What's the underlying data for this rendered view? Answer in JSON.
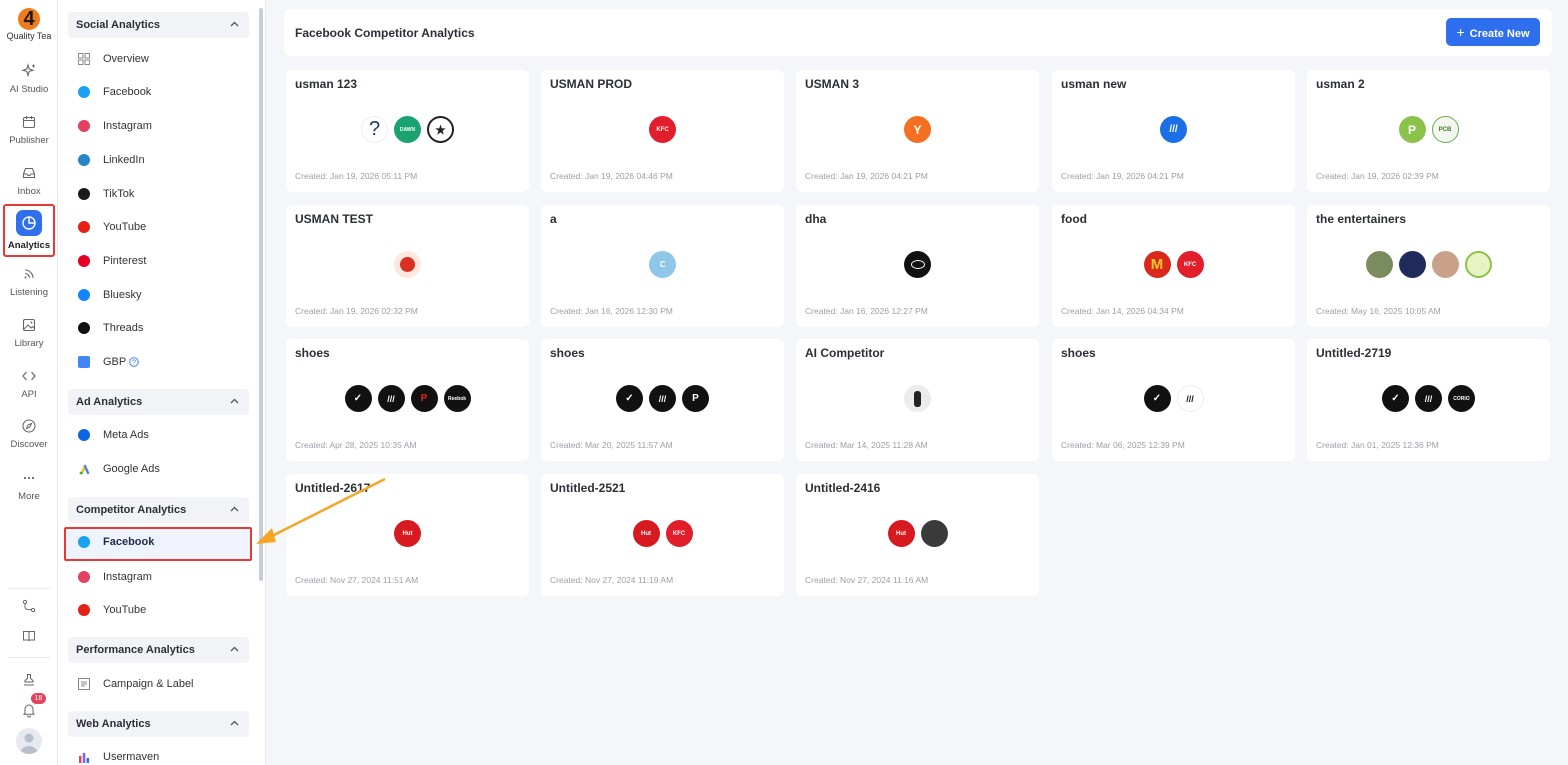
{
  "rail": {
    "logo_text": "Quality Tea",
    "items": [
      {
        "label": "AI Studio",
        "icon": "sparkle-icon"
      },
      {
        "label": "Publisher",
        "icon": "calendar-icon"
      },
      {
        "label": "Inbox",
        "icon": "inbox-icon"
      },
      {
        "label": "Analytics",
        "icon": "pie-chart-icon"
      },
      {
        "label": "Listening",
        "icon": "rss-icon"
      },
      {
        "label": "Library",
        "icon": "image-icon"
      },
      {
        "label": "API",
        "icon": "code-icon"
      },
      {
        "label": "Discover",
        "icon": "compass-icon"
      },
      {
        "label": "More",
        "icon": "ellipsis-icon"
      }
    ],
    "notification_count": "18"
  },
  "sidebar": {
    "social_analytics": {
      "heading": "Social Analytics",
      "items": [
        "Overview",
        "Facebook",
        "Instagram",
        "LinkedIn",
        "TikTok",
        "YouTube",
        "Pinterest",
        "Bluesky",
        "Threads",
        "GBP"
      ]
    },
    "ad_analytics": {
      "heading": "Ad Analytics",
      "items": [
        "Meta Ads",
        "Google Ads"
      ]
    },
    "competitor_analytics": {
      "heading": "Competitor Analytics",
      "items": [
        "Facebook",
        "Instagram",
        "YouTube"
      ]
    },
    "performance_analytics": {
      "heading": "Performance Analytics",
      "items": [
        "Campaign & Label"
      ]
    },
    "web_analytics": {
      "heading": "Web Analytics",
      "items": [
        "Usermaven"
      ]
    }
  },
  "header": {
    "title": "Facebook Competitor Analytics",
    "create_label": "Create New"
  },
  "cards": [
    {
      "name": "usman 123",
      "created": "Created: Jan 19, 2026 05:11 PM"
    },
    {
      "name": "USMAN PROD",
      "created": "Created: Jan 19, 2026 04:46 PM"
    },
    {
      "name": "USMAN 3",
      "created": "Created: Jan 19, 2026 04:21 PM"
    },
    {
      "name": "usman new",
      "created": "Created: Jan 19, 2026 04:21 PM"
    },
    {
      "name": "usman 2",
      "created": "Created: Jan 19, 2026 02:39 PM"
    },
    {
      "name": "USMAN TEST",
      "created": "Created: Jan 19, 2026 02:32 PM"
    },
    {
      "name": "a",
      "created": "Created: Jan 16, 2026 12:30 PM"
    },
    {
      "name": "dha",
      "created": "Created: Jan 16, 2026 12:27 PM"
    },
    {
      "name": "food",
      "created": "Created: Jan 14, 2026 04:34 PM"
    },
    {
      "name": "the entertainers",
      "created": "Created: May 16, 2025 10:05 AM"
    },
    {
      "name": "shoes",
      "created": "Created: Apr 28, 2025 10:35 AM"
    },
    {
      "name": "shoes",
      "created": "Created: Mar 20, 2025 11:57 AM"
    },
    {
      "name": "AI Competitor",
      "created": "Created: Mar 14, 2025 11:28 AM"
    },
    {
      "name": "shoes",
      "created": "Created: Mar 06, 2025 12:39 PM"
    },
    {
      "name": "Untitled-2719",
      "created": "Created: Jan 01, 2025 12:36 PM"
    },
    {
      "name": "Untitled-2617",
      "created": "Created: Nov 27, 2024 11:51 AM"
    },
    {
      "name": "Untitled-2521",
      "created": "Created: Nov 27, 2024 11:19 AM"
    },
    {
      "name": "Untitled-2416",
      "created": "Created: Nov 27, 2024 11:16 AM"
    }
  ],
  "colors": {
    "accent": "#2f6fed",
    "highlight": "#e53935",
    "arrow": "#f5a623"
  }
}
